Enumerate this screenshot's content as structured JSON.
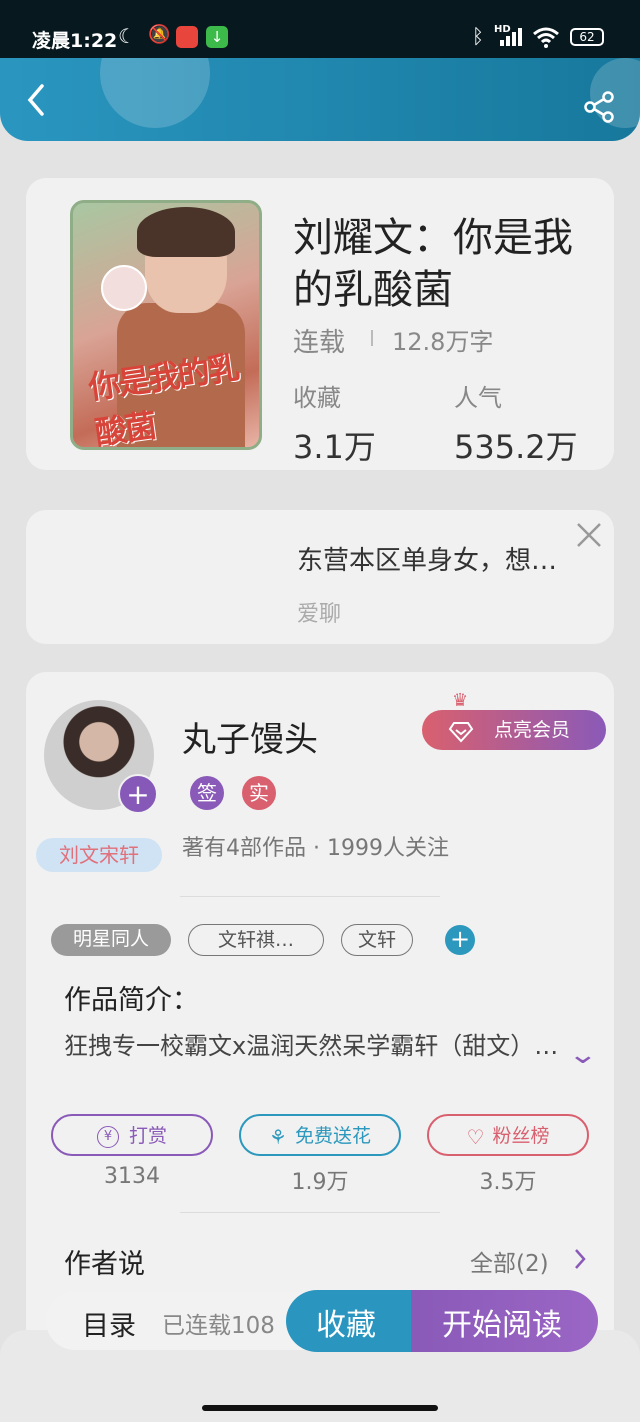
{
  "status_bar": {
    "time": "凌晨1:22",
    "battery": "62",
    "network": "HD"
  },
  "book": {
    "title": "刘耀文：你是我的乳酸菌",
    "status": "连载",
    "word_count": "12.8万字",
    "stats": [
      {
        "label": "收藏",
        "value": "3.1万"
      },
      {
        "label": "人气",
        "value": "535.2万"
      }
    ],
    "cover_text": "你是我的乳酸菌"
  },
  "ad": {
    "title": "东营本区单身女，想…",
    "source": "爱聊"
  },
  "author": {
    "name": "丸子馒头",
    "badges": [
      "签",
      "实"
    ],
    "meta": "著有4部作品 · 1999人关注",
    "fan_tag": "刘文宋轩",
    "vip_button": "点亮会员"
  },
  "tags": [
    "明星同人",
    "文轩祺…",
    "文轩"
  ],
  "synopsis": {
    "heading": "作品简介：",
    "text": "狂拽专一校霸文x温润天然呆学霸轩（甜文）…"
  },
  "actions": [
    {
      "label": "打赏",
      "count": "3134",
      "color": "#8a5ab8"
    },
    {
      "label": "免费送花",
      "count": "1.9万",
      "color": "#2d98bd"
    },
    {
      "label": "粉丝榜",
      "count": "3.5万",
      "color": "#d9606e"
    }
  ],
  "author_says": {
    "heading": "作者说",
    "all_label": "全部(2)"
  },
  "bottom": {
    "toc_label": "目录",
    "progress": "已连载108",
    "fav_button": "收藏",
    "read_button": "开始阅读"
  }
}
